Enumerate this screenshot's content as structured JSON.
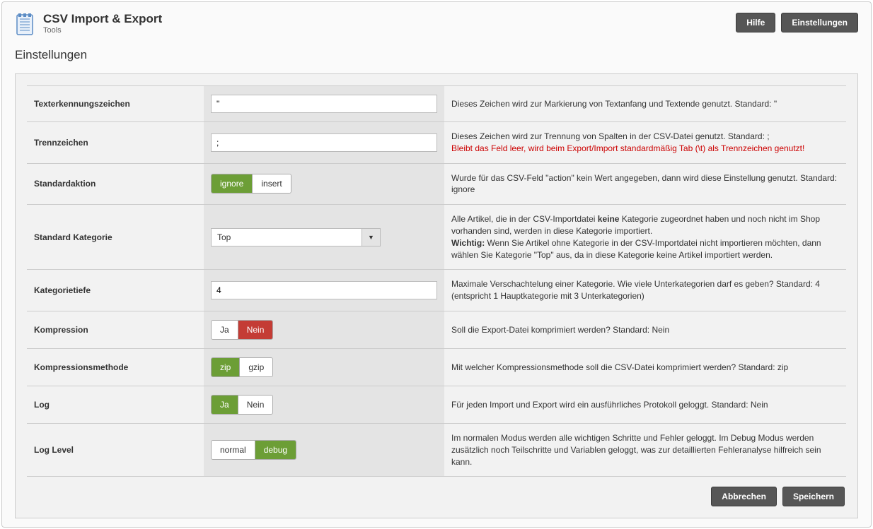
{
  "header": {
    "title": "CSV Import & Export",
    "subtitle": "Tools",
    "help_button": "Hilfe",
    "settings_button": "Einstellungen"
  },
  "section_title": "Einstellungen",
  "rows": {
    "text_marker": {
      "label": "Texterkennungszeichen",
      "value": "\"",
      "desc": "Dieses Zeichen wird zur Markierung von Textanfang und Textende genutzt. Standard: \""
    },
    "separator": {
      "label": "Trennzeichen",
      "value": ";",
      "desc": "Dieses Zeichen wird zur Trennung von Spalten in der CSV-Datei genutzt. Standard: ;",
      "warn": "Bleibt das Feld leer, wird beim Export/Import standardmäßig Tab (\\t) als Trennzeichen genutzt!"
    },
    "default_action": {
      "label": "Standardaktion",
      "opt1": "ignore",
      "opt2": "insert",
      "desc": "Wurde für das CSV-Feld \"action\" kein Wert angegeben, dann wird diese Einstellung genutzt. Standard: ignore"
    },
    "default_category": {
      "label": "Standard Kategorie",
      "value": "Top",
      "desc_a": "Alle Artikel, die in der CSV-Importdatei ",
      "desc_b_bold": "keine",
      "desc_c": " Kategorie zugeordnet haben und noch nicht im Shop vorhanden sind, werden in diese Kategorie importiert.",
      "desc_d_bold": "Wichtig:",
      "desc_e": " Wenn Sie Artikel ohne Kategorie in der CSV-Importdatei nicht importieren möchten, dann wählen Sie Kategorie \"Top\" aus, da in diese Kategorie keine Artikel importiert werden."
    },
    "category_depth": {
      "label": "Kategorietiefe",
      "value": "4",
      "desc": "Maximale Verschachtelung einer Kategorie. Wie viele Unterkategorien darf es geben? Standard: 4 (entspricht 1 Hauptkategorie mit 3 Unterkategorien)"
    },
    "compression": {
      "label": "Kompression",
      "opt1": "Ja",
      "opt2": "Nein",
      "desc": "Soll die Export-Datei komprimiert werden? Standard: Nein"
    },
    "compression_method": {
      "label": "Kompressionsmethode",
      "opt1": "zip",
      "opt2": "gzip",
      "desc": "Mit welcher Kompressionsmethode soll die CSV-Datei komprimiert werden? Standard: zip"
    },
    "log": {
      "label": "Log",
      "opt1": "Ja",
      "opt2": "Nein",
      "desc": "Für jeden Import und Export wird ein ausführliches Protokoll geloggt. Standard: Nein"
    },
    "log_level": {
      "label": "Log Level",
      "opt1": "normal",
      "opt2": "debug",
      "desc": "Im normalen Modus werden alle wichtigen Schritte und Fehler geloggt. Im Debug Modus werden zusätzlich noch Teilschritte und Variablen geloggt, was zur detaillierten Fehleranalyse hilfreich sein kann."
    }
  },
  "footer": {
    "cancel": "Abbrechen",
    "save": "Speichern"
  }
}
